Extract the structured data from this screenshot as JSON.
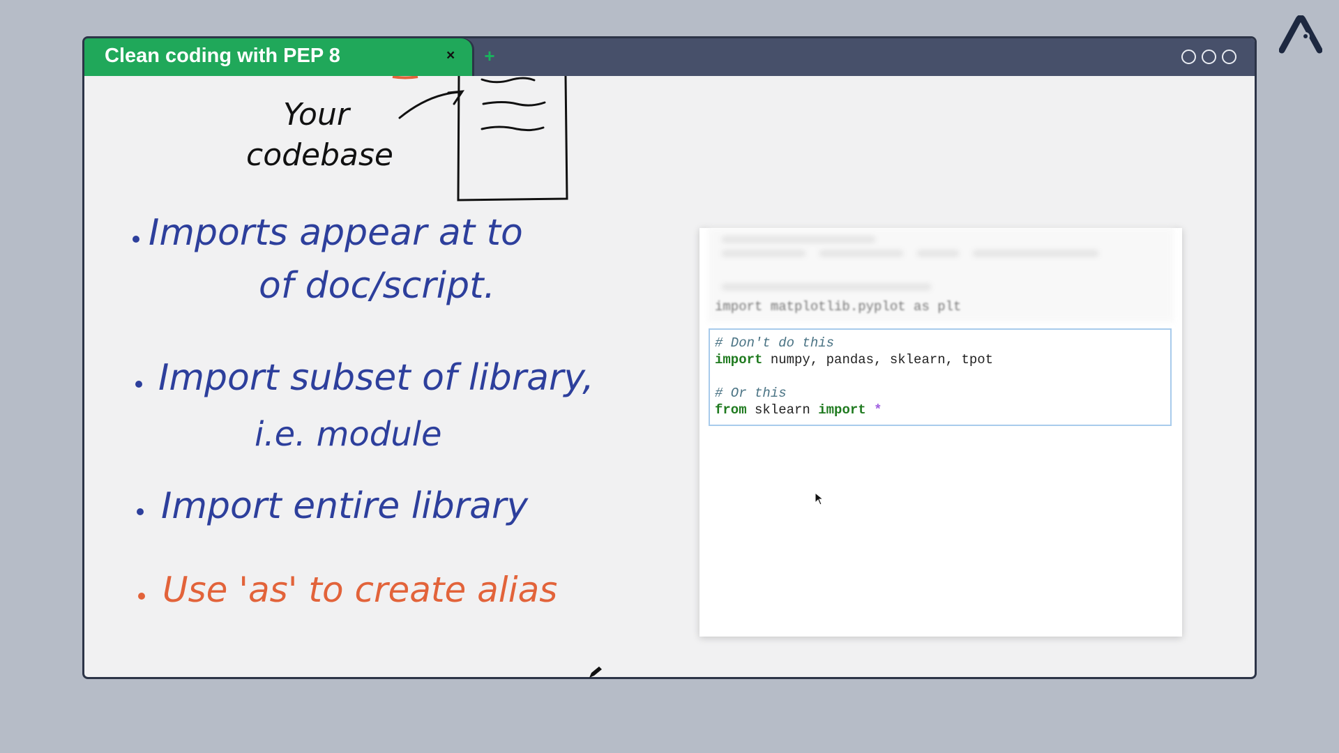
{
  "window": {
    "tab_title": "Clean coding with PEP 8",
    "tab_close": "×",
    "new_tab": "+"
  },
  "whiteboard": {
    "codebase_label_line1": "Your",
    "codebase_label_line2": "codebase",
    "bullets": [
      {
        "line1": "Imports appear at to",
        "line2": "of doc/script.",
        "color": "#2d3f9c"
      },
      {
        "line1": "Import subset of library,",
        "line2": "i.e. module",
        "color": "#2d3f9c"
      },
      {
        "line1": "Import entire library",
        "line2": "",
        "color": "#2d3f9c"
      },
      {
        "line1": "Use 'as' to create alias",
        "line2": "",
        "color": "#e2633a"
      }
    ]
  },
  "code": {
    "blurred_line": "import matplotlib.pyplot as plt",
    "cell_lines": [
      "# Don't do this",
      "import numpy, pandas, sklearn, tpot",
      "",
      "# Or this",
      "from sklearn import *"
    ]
  },
  "icons": [
    "app-logo-icon",
    "close-icon",
    "plus-icon",
    "window-control-icon",
    "mouse-pointer-icon",
    "pen-icon"
  ],
  "colors": {
    "tab_green": "#20a85a",
    "titlebar": "#47506a",
    "ink_blue": "#2d3f9c",
    "ink_orange": "#e2633a"
  }
}
